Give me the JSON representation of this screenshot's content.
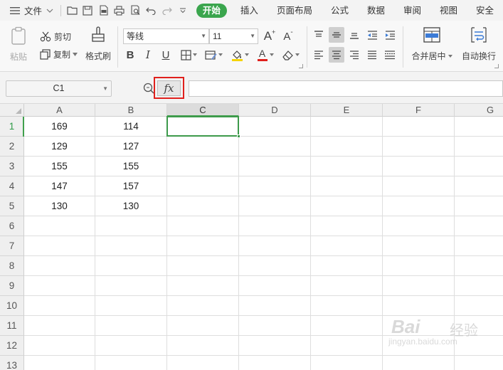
{
  "menubar": {
    "file_label": "文件",
    "tabs": [
      {
        "label": "开始",
        "active": true
      },
      {
        "label": "插入",
        "active": false
      },
      {
        "label": "页面布局",
        "active": false
      },
      {
        "label": "公式",
        "active": false
      },
      {
        "label": "数据",
        "active": false
      },
      {
        "label": "审阅",
        "active": false
      },
      {
        "label": "视图",
        "active": false
      },
      {
        "label": "安全",
        "active": false
      }
    ],
    "active_color": "#3aa54d"
  },
  "ribbon": {
    "paste_label": "粘贴",
    "cut_label": "剪切",
    "copy_label": "复制",
    "format_painter_label": "格式刷",
    "font_name": "等线",
    "font_size": "11",
    "bold_glyph": "B",
    "italic_glyph": "I",
    "underline_glyph": "U",
    "grow_font_glyph": "A",
    "shrink_font_glyph": "A",
    "font_color_glyph": "A",
    "merge_center_label": "合并居中",
    "wrap_text_label": "自动换行"
  },
  "formula_bar": {
    "name_box": "C1",
    "fx_label": "fx",
    "formula_value": "",
    "highlight_color": "#e0201c"
  },
  "sheet": {
    "columns": [
      "A",
      "B",
      "C",
      "D",
      "E",
      "F",
      "G"
    ],
    "rows": [
      "1",
      "2",
      "3",
      "4",
      "5",
      "6",
      "7",
      "8",
      "9",
      "10",
      "11",
      "12",
      "13"
    ],
    "cells": [
      [
        "169",
        "114"
      ],
      [
        "129",
        "127"
      ],
      [
        "155",
        "155"
      ],
      [
        "147",
        "157"
      ],
      [
        "130",
        "130"
      ]
    ],
    "selected_cell": "C1",
    "selection_color": "#3d9a4b"
  },
  "watermark": {
    "brand": "Bai",
    "suffix": "经验",
    "domain": "jingyan.baidu.com"
  }
}
